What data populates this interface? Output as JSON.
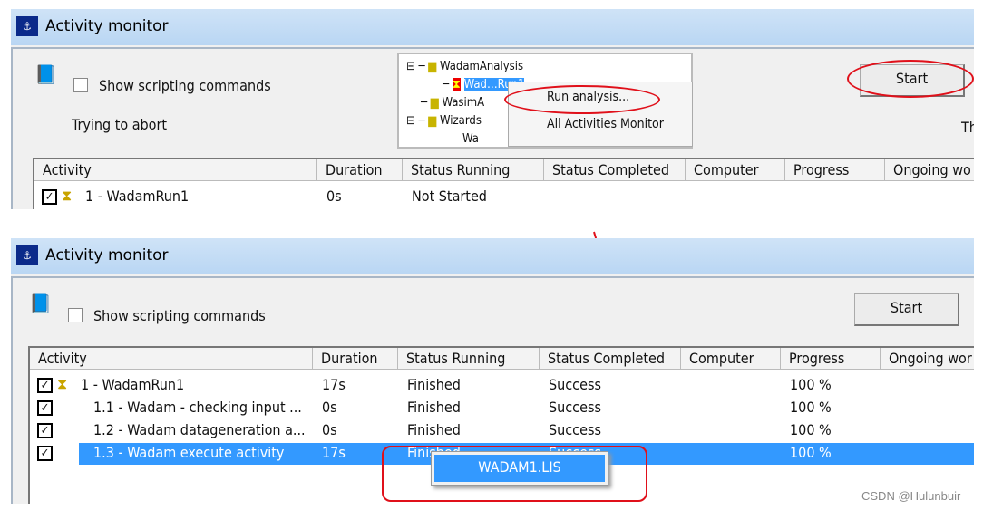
{
  "top": {
    "title": "Activity monitor",
    "show_scripting_label": "Show scripting commands",
    "status_text": "Trying to abort",
    "start_label": "Start",
    "clipped_text": "Th",
    "tree": {
      "items": [
        "WadamAnalysis",
        "Wad…Run1",
        "WasimA",
        "Wizards",
        "Wa"
      ]
    },
    "context_menu": [
      "Run analysis...",
      "All Activities Monitor"
    ],
    "columns": [
      "Activity",
      "Duration",
      "Status Running",
      "Status Completed",
      "Computer",
      "Progress",
      "Ongoing wo"
    ],
    "rows": [
      {
        "activity": "1 - WadamRun1",
        "duration": "0s",
        "status_running": "Not Started"
      }
    ]
  },
  "bottom": {
    "title": "Activity monitor",
    "show_scripting_label": "Show scripting commands",
    "start_label": "Start",
    "columns": [
      "Activity",
      "Duration",
      "Status Running",
      "Status Completed",
      "Computer",
      "Progress",
      "Ongoing wor"
    ],
    "rows": [
      {
        "activity": "1 - WadamRun1",
        "duration": "17s",
        "status_running": "Finished",
        "status_completed": "Success",
        "progress": "100 %"
      },
      {
        "activity": "1.1 - Wadam - checking input ...",
        "duration": "0s",
        "status_running": "Finished",
        "status_completed": "Success",
        "progress": "100 %"
      },
      {
        "activity": "1.2 - Wadam datageneration a...",
        "duration": "0s",
        "status_running": "Finished",
        "status_completed": "Success",
        "progress": "100 %"
      },
      {
        "activity": "1.3 - Wadam execute activity",
        "duration": "17s",
        "status_running": "Finished",
        "status_completed": "Success",
        "progress": "100 %"
      }
    ],
    "popup_item": "WADAM1.LIS"
  },
  "watermark": "CSDN @Hulunbuir",
  "colors": {
    "highlight": "#3399ff",
    "annotation": "#e0101a"
  }
}
